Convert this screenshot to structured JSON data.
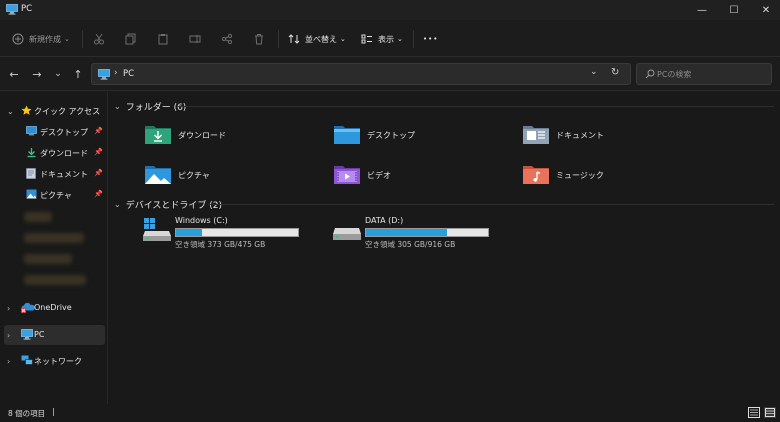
{
  "window": {
    "title": "PC",
    "minimize_glyph": "—",
    "maximize_glyph": "☐",
    "close_glyph": "✕"
  },
  "toolbar": {
    "new_label": "新規作成",
    "sort_label": "並べ替え",
    "view_label": "表示",
    "more_glyph": "•••"
  },
  "address": {
    "breadcrumb": "PC"
  },
  "search": {
    "placeholder": "PCの検索"
  },
  "sidebar": {
    "quick_access": "クイック アクセス",
    "pinned": [
      {
        "label": "デスクトップ",
        "icon": "desktop-icon"
      },
      {
        "label": "ダウンロード",
        "icon": "download-icon"
      },
      {
        "label": "ドキュメント",
        "icon": "document-icon"
      },
      {
        "label": "ピクチャ",
        "icon": "picture-icon"
      }
    ],
    "onedrive": "OneDrive",
    "pc": "PC",
    "network": "ネットワーク"
  },
  "folders_group": {
    "title": "フォルダー (6)",
    "items": [
      {
        "label": "ダウンロード",
        "icon": "download-folder-icon"
      },
      {
        "label": "デスクトップ",
        "icon": "desktop-folder-icon"
      },
      {
        "label": "ドキュメント",
        "icon": "documents-folder-icon"
      },
      {
        "label": "ピクチャ",
        "icon": "pictures-folder-icon"
      },
      {
        "label": "ビデオ",
        "icon": "videos-folder-icon"
      },
      {
        "label": "ミュージック",
        "icon": "music-folder-icon"
      }
    ]
  },
  "drives_group": {
    "title": "デバイスとドライブ (2)",
    "items": [
      {
        "name": "Windows (C:)",
        "space": "空き領域 373 GB/475 GB",
        "used_fraction": 0.215
      },
      {
        "name": "DATA (D:)",
        "space": "空き領域 305 GB/916 GB",
        "used_fraction": 0.667
      }
    ]
  },
  "status": {
    "item_count": "8 個の項目"
  },
  "colors": {
    "accent": "#26a0da",
    "folder_yellow": "#e8b84a"
  }
}
